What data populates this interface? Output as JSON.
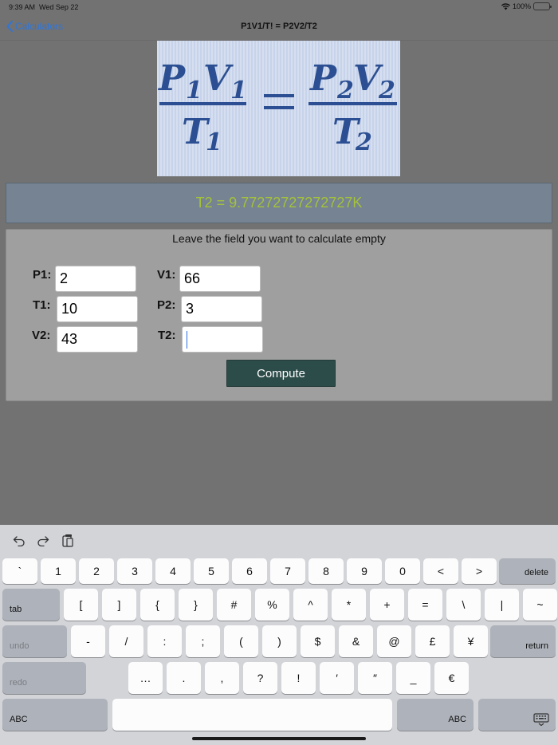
{
  "status_bar": {
    "time": "9:39 AM",
    "date": "Wed Sep 22",
    "battery": "100%"
  },
  "nav": {
    "back_label": "Calculators",
    "title": "P1V1/T! = P2V2/T2"
  },
  "result": {
    "text": "T2 = 9.77272727272727K"
  },
  "form": {
    "hint": "Leave the field you want to calculate empty",
    "fields": [
      {
        "label": "P1:",
        "value": "2"
      },
      {
        "label": "V1:",
        "value": "66"
      },
      {
        "label": "T1:",
        "value": "10"
      },
      {
        "label": "P2:",
        "value": "3"
      },
      {
        "label": "V2:",
        "value": "43"
      },
      {
        "label": "T2:",
        "value": ""
      }
    ],
    "compute_label": "Compute"
  },
  "keyboard": {
    "row1": [
      "`",
      "1",
      "2",
      "3",
      "4",
      "5",
      "6",
      "7",
      "8",
      "9",
      "0",
      "<",
      ">"
    ],
    "row1_special": "delete",
    "row2_special": "tab",
    "row2": [
      "[",
      "]",
      "{",
      "}",
      "#",
      "%",
      "^",
      "*",
      "+",
      "=",
      "\\",
      "|",
      "~"
    ],
    "row3_special": "undo",
    "row3": [
      "-",
      "/",
      ":",
      ";",
      "(",
      ")",
      "$",
      "&",
      "@",
      "£",
      "¥"
    ],
    "row3_return": "return",
    "row4_special": "redo",
    "row4": [
      "…",
      ".",
      ",",
      "?",
      "!",
      "′",
      "″",
      "_",
      "€"
    ],
    "abc_left": "ABC",
    "abc_right": "ABC"
  }
}
